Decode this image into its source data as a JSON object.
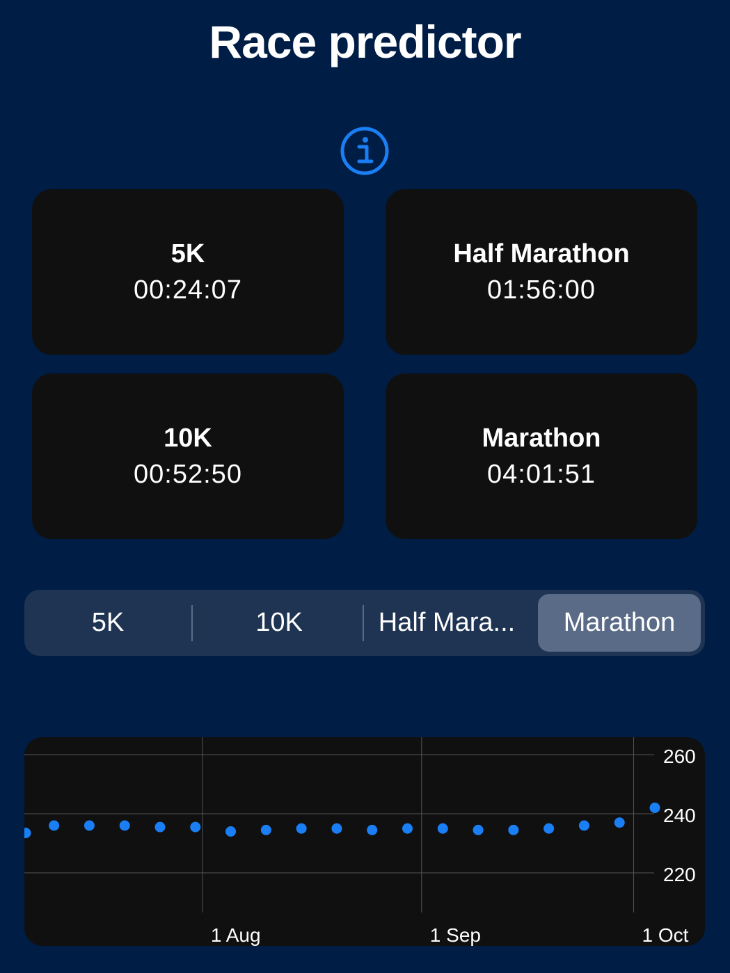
{
  "header": {
    "title": "Race predictor"
  },
  "info_button": {
    "icon": "info-circle-icon",
    "color": "#1a7ff5"
  },
  "predictions": [
    {
      "label": "5K",
      "time": "00:24:07"
    },
    {
      "label": "Half Marathon",
      "time": "01:56:00"
    },
    {
      "label": "10K",
      "time": "00:52:50"
    },
    {
      "label": "Marathon",
      "time": "04:01:51"
    }
  ],
  "segmented_control": {
    "options": [
      "5K",
      "10K",
      "Half Mara...",
      "Marathon"
    ],
    "selected": "Marathon"
  },
  "chart_data": {
    "type": "scatter",
    "x_ticks": [
      "1 Aug",
      "1 Sep",
      "1 Oct"
    ],
    "y_ticks": [
      260,
      240,
      220
    ],
    "ylim": [
      200,
      265
    ],
    "grid": true,
    "point_color": "#1a7ff5",
    "series": [
      {
        "x": [
          "2023-07-07",
          "2023-07-11",
          "2023-07-16",
          "2023-07-21",
          "2023-07-26",
          "2023-07-31",
          "2023-08-05",
          "2023-08-10",
          "2023-08-15",
          "2023-08-20",
          "2023-08-25",
          "2023-08-30",
          "2023-09-04",
          "2023-09-09",
          "2023-09-14",
          "2023-09-19",
          "2023-09-24",
          "2023-09-29",
          "2023-10-04"
        ],
        "y": [
          233.5,
          236,
          236,
          236,
          235.5,
          235.5,
          234,
          234.5,
          235,
          235,
          234.5,
          235,
          235,
          234.5,
          234.5,
          235,
          236,
          237,
          242
        ]
      }
    ]
  }
}
